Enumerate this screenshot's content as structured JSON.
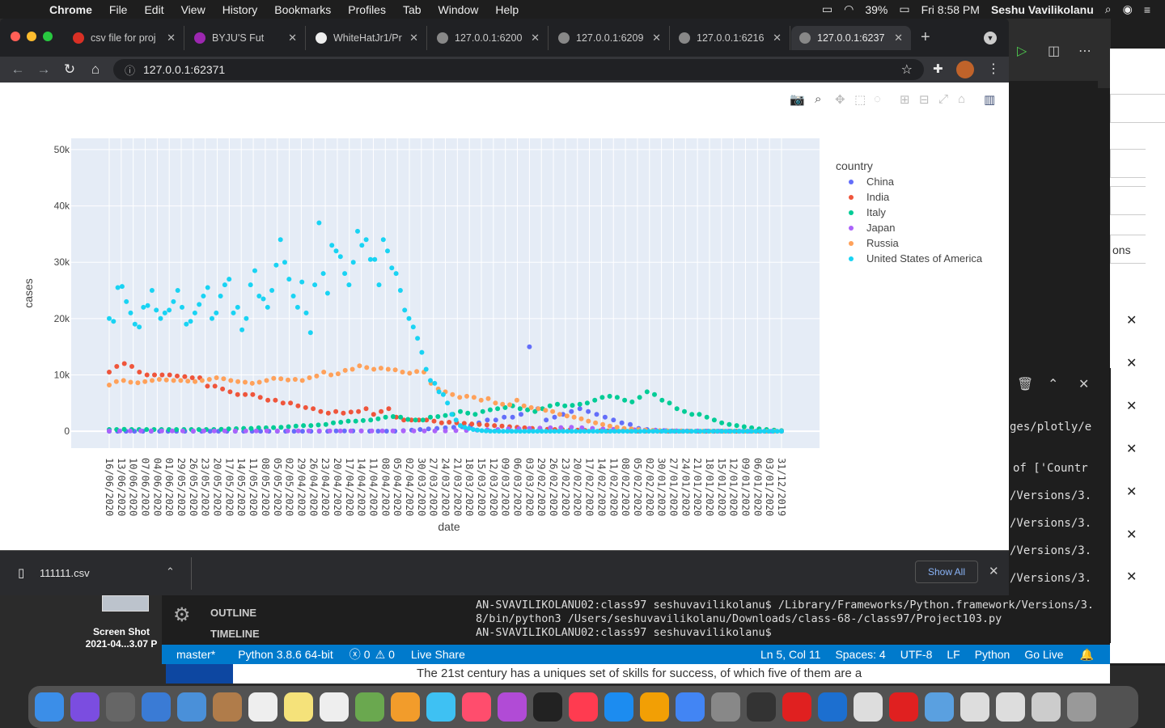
{
  "menubar": {
    "app": "Chrome",
    "items": [
      "File",
      "Edit",
      "View",
      "History",
      "Bookmarks",
      "Profiles",
      "Tab",
      "Window",
      "Help"
    ],
    "battery": "39%",
    "clock": "Fri 8:58 PM",
    "user": "Seshu Vavilikolanu"
  },
  "tabs": [
    {
      "label": "csv file for proj",
      "icon": "gmail-icon",
      "color": "#d93025"
    },
    {
      "label": "BYJU'S Fut",
      "icon": "byjus-icon",
      "color": "#9c27b0"
    },
    {
      "label": "WhiteHatJr1/Pr",
      "icon": "github-icon",
      "color": "#eeeeee"
    },
    {
      "label": "127.0.0.1:6200",
      "icon": "globe-icon",
      "color": "#888888"
    },
    {
      "label": "127.0.0.1:6209",
      "icon": "globe-icon",
      "color": "#888888"
    },
    {
      "label": "127.0.0.1:6216",
      "icon": "globe-icon",
      "color": "#888888"
    },
    {
      "label": "127.0.0.1:6237",
      "icon": "globe-icon",
      "color": "#888888"
    }
  ],
  "url": "127.0.0.1:62371",
  "download": {
    "file": "111111.csv",
    "show_all": "Show All"
  },
  "chart_data": {
    "type": "scatter",
    "xlabel": "date",
    "ylabel": "cases",
    "ylim": [
      -3000,
      52000
    ],
    "yticks": [
      0,
      10000,
      20000,
      30000,
      40000,
      50000
    ],
    "ytick_labels": [
      "0",
      "10k",
      "20k",
      "30k",
      "40k",
      "50k"
    ],
    "legend_title": "country",
    "legend_position": "right",
    "x_tick_labels": [
      "16/06/2020",
      "13/06/2020",
      "10/06/2020",
      "07/06/2020",
      "04/06/2020",
      "01/06/2020",
      "29/05/2020",
      "26/05/2020",
      "23/05/2020",
      "20/05/2020",
      "17/05/2020",
      "14/05/2020",
      "11/05/2020",
      "08/05/2020",
      "05/05/2020",
      "02/05/2020",
      "29/04/2020",
      "26/04/2020",
      "23/04/2020",
      "20/04/2020",
      "17/04/2020",
      "14/04/2020",
      "11/04/2020",
      "08/04/2020",
      "05/04/2020",
      "02/04/2020",
      "30/03/2020",
      "27/03/2020",
      "24/03/2020",
      "21/03/2020",
      "18/03/2020",
      "15/03/2020",
      "12/03/2020",
      "09/03/2020",
      "06/03/2020",
      "03/03/2020",
      "29/02/2020",
      "26/02/2020",
      "23/02/2020",
      "20/02/2020",
      "17/02/2020",
      "14/02/2020",
      "11/02/2020",
      "08/02/2020",
      "05/02/2020",
      "02/02/2020",
      "30/01/2020",
      "27/01/2020",
      "24/01/2020",
      "21/01/2020",
      "18/01/2020",
      "15/01/2020",
      "12/01/2020",
      "09/01/2020",
      "06/01/2020",
      "03/01/2020",
      "31/12/2019"
    ],
    "series": [
      {
        "name": "China",
        "color": "#636efa",
        "values": [
          0,
          0,
          0,
          0,
          0,
          0,
          0,
          0,
          0,
          0,
          0,
          0,
          0,
          0,
          0,
          0,
          0,
          0,
          0,
          0,
          0,
          0,
          0,
          0,
          0,
          0,
          0,
          50,
          50,
          50,
          50,
          20,
          20,
          20,
          20,
          100,
          200,
          300,
          400,
          500,
          600,
          700,
          800,
          1000,
          1500,
          2000,
          2000,
          2500,
          2500,
          3000,
          15000,
          4000,
          2000,
          2500,
          3000,
          3500,
          4000,
          3500,
          3000,
          2500,
          2000,
          1500,
          1200,
          500,
          300,
          200,
          100,
          50,
          20,
          10,
          5,
          0,
          0,
          0,
          0,
          0,
          0,
          0,
          0,
          0,
          0
        ]
      },
      {
        "name": "India",
        "color": "#ef553b",
        "values": [
          10500,
          11500,
          12000,
          11500,
          10500,
          10000,
          10000,
          10000,
          10000,
          9800,
          9700,
          9500,
          9500,
          8000,
          8000,
          7500,
          7000,
          6500,
          6500,
          6500,
          6000,
          5500,
          5500,
          5000,
          5000,
          4500,
          4200,
          4000,
          3500,
          3200,
          3500,
          3200,
          3400,
          3500,
          4000,
          3000,
          3500,
          4000,
          2500,
          2000,
          2000,
          2000,
          2000,
          1800,
          1500,
          1600,
          1500,
          1400,
          1300,
          1200,
          1100,
          1000,
          900,
          800,
          700,
          600,
          500,
          400,
          350,
          300,
          300,
          250,
          200,
          150,
          100,
          80,
          60,
          50,
          40,
          30,
          20,
          10,
          5,
          3,
          2,
          1,
          0,
          0,
          0,
          0,
          0,
          0,
          0,
          0,
          0,
          0,
          0,
          0,
          0,
          0
        ]
      },
      {
        "name": "Italy",
        "color": "#00cc96",
        "values": [
          300,
          300,
          350,
          300,
          300,
          300,
          300,
          300,
          300,
          300,
          300,
          300,
          300,
          300,
          300,
          350,
          400,
          450,
          500,
          500,
          600,
          600,
          650,
          700,
          800,
          900,
          1000,
          1000,
          1100,
          1200,
          1500,
          1600,
          1800,
          1800,
          1900,
          2000,
          2200,
          2500,
          2600,
          2500,
          2100,
          2000,
          2000,
          2500,
          2600,
          2800,
          3000,
          3500,
          3200,
          3000,
          3500,
          3800,
          4000,
          4200,
          4500,
          4000,
          3800,
          3500,
          4000,
          4500,
          4800,
          4500,
          4600,
          4800,
          5000,
          5500,
          6000,
          6200,
          6000,
          5500,
          5200,
          6000,
          7000,
          6500,
          5500,
          5000,
          4000,
          3500,
          3000,
          3000,
          2500,
          2000,
          1500,
          1200,
          1000,
          800,
          600,
          400,
          300,
          200,
          100
        ]
      },
      {
        "name": "Japan",
        "color": "#ab63fa",
        "values": [
          50,
          50,
          50,
          50,
          50,
          50,
          50,
          50,
          50,
          50,
          50,
          50,
          50,
          50,
          50,
          50,
          50,
          50,
          50,
          50,
          50,
          50,
          50,
          50,
          50,
          50,
          50,
          50,
          50,
          50,
          50,
          50,
          50,
          100,
          150,
          200,
          250,
          300,
          400,
          450,
          500,
          550,
          600,
          650,
          700,
          600,
          500,
          400,
          350,
          300,
          250,
          200,
          150,
          100,
          80,
          60,
          40,
          30,
          20,
          10,
          5,
          0,
          0,
          0,
          0
        ]
      },
      {
        "name": "Russia",
        "color": "#ffa15a",
        "values": [
          8200,
          8800,
          9000,
          8700,
          8600,
          8800,
          9000,
          9200,
          9100,
          9000,
          9000,
          8900,
          8800,
          9000,
          9200,
          9500,
          9300,
          9000,
          8800,
          8700,
          8500,
          8700,
          9000,
          9400,
          9300,
          9100,
          9200,
          9000,
          9500,
          9800,
          10500,
          10000,
          10200,
          10800,
          11000,
          11600,
          11300,
          11000,
          11200,
          11000,
          10900,
          10500,
          10300,
          10600,
          10500,
          8500,
          7500,
          7000,
          6500,
          6000,
          6200,
          6000,
          5500,
          5800,
          5000,
          4800,
          4700,
          5500,
          4500,
          4200,
          4000,
          3700,
          3500,
          3000,
          2700,
          2500,
          2200,
          1800,
          1500,
          1200,
          900,
          700,
          500,
          400,
          300,
          200,
          150,
          100,
          80,
          60,
          40,
          20,
          10,
          5,
          0,
          0,
          0,
          0,
          0,
          0,
          0,
          0,
          0,
          0,
          0
        ]
      },
      {
        "name": "United States of America",
        "color": "#19d3f3",
        "values": [
          20000,
          19500,
          25500,
          25700,
          23000,
          21000,
          19000,
          18500,
          22000,
          22300,
          25000,
          21500,
          20000,
          21000,
          21500,
          23000,
          25000,
          22000,
          19000,
          19500,
          21000,
          22500,
          24000,
          25500,
          20000,
          21000,
          24000,
          26000,
          27000,
          21000,
          22000,
          18000,
          20000,
          26000,
          28500,
          24000,
          23500,
          22000,
          25000,
          29500,
          34000,
          30000,
          27000,
          24000,
          22000,
          26500,
          21000,
          17500,
          26000,
          37000,
          28000,
          24500,
          33000,
          32000,
          31000,
          28000,
          26000,
          30000,
          35500,
          33000,
          34000,
          30500,
          30500,
          26000,
          34000,
          32000,
          29000,
          28000,
          25000,
          21500,
          20000,
          18500,
          16500,
          14000,
          11000,
          9000,
          8500,
          7000,
          6500,
          5000,
          3000,
          2000,
          1000,
          700,
          500,
          300,
          200,
          100,
          50,
          20,
          10,
          0,
          0,
          0,
          0,
          0,
          0,
          0,
          0,
          0,
          0,
          0,
          0,
          0,
          0,
          0,
          0,
          0,
          0,
          0,
          0,
          0,
          0,
          0,
          0,
          0,
          0,
          0,
          0,
          0,
          0,
          0,
          0,
          0,
          0,
          0,
          0,
          0,
          0,
          0,
          0,
          0,
          0,
          0,
          0,
          0,
          0,
          0,
          0,
          0,
          0,
          0,
          0,
          0,
          0,
          0,
          0,
          0,
          0,
          0,
          0,
          0,
          0,
          0,
          0,
          0,
          0,
          0
        ]
      }
    ]
  },
  "vscode": {
    "terminal_lines": [
      "ges/plotly/e",
      "of ['Countr",
      "/Versions/3.",
      "/Versions/3.",
      "/Versions/3.",
      "/Versions/3."
    ],
    "outline": "OUTLINE",
    "timeline": "TIMELINE",
    "term_main_1": "AN-SVAVILIKOLANU02:class97 seshuvavilikolanu$ /Library/Frameworks/Python.framework/Versions/3.",
    "term_main_2": "8/bin/python3 /Users/seshuvavilikolanu/Downloads/class-68-/class97/Project103.py",
    "term_main_3": "AN-SVAVILIKOLANU02:class97 seshuvavilikolanu$",
    "status": {
      "branch": "master*",
      "python": "Python 3.8.6 64-bit",
      "errors": "0",
      "warnings": "0",
      "live_share": "Live Share",
      "position": "Ln 5, Col 11",
      "spaces": "Spaces: 4",
      "encoding": "UTF-8",
      "eol": "LF",
      "lang": "Python",
      "go_live": "Go Live"
    },
    "right_panel_text": "ons"
  },
  "desktop": {
    "screenshot_label_1": "Screen Shot",
    "screenshot_label_2": "2021-04...3.07 P",
    "page_text": "The 21st century has a uniques set of skills for success, of which five of them are a"
  }
}
